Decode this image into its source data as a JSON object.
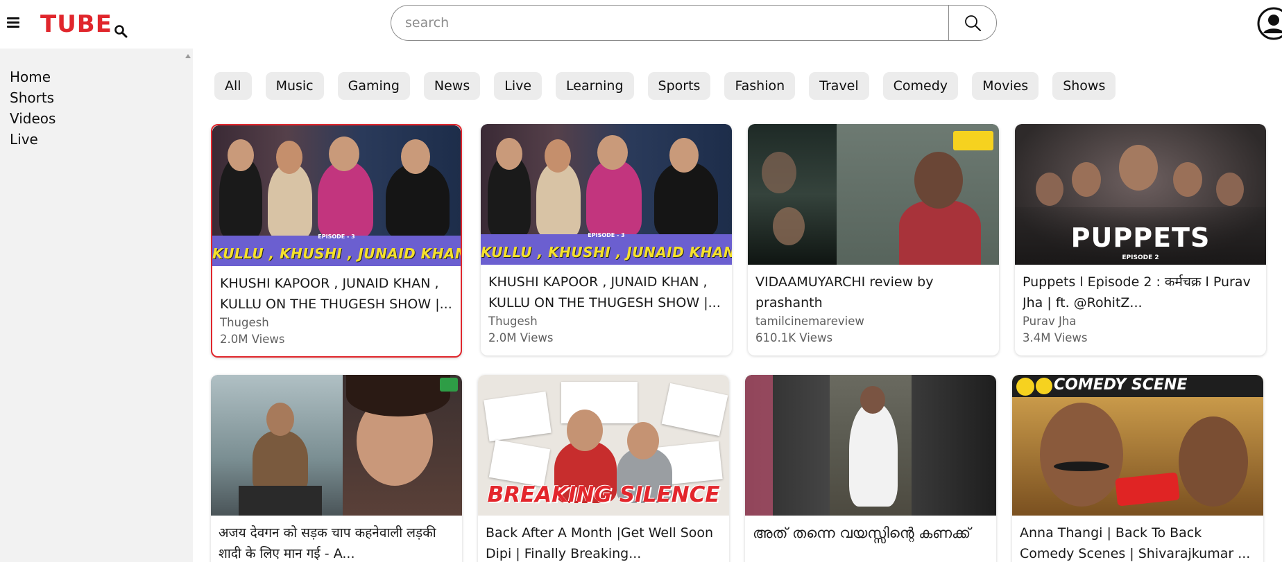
{
  "header": {
    "logo_text": "TUBE",
    "logo_icon": "magnifier-icon",
    "search_placeholder": "search",
    "search_icon": "search-icon",
    "avatar_icon": "user-avatar-icon",
    "menu_icon": "hamburger-menu-icon",
    "brand_color": "#e0262c"
  },
  "sidebar": {
    "items": [
      {
        "label": "Home"
      },
      {
        "label": "Shorts"
      },
      {
        "label": "Videos"
      },
      {
        "label": "Live"
      }
    ]
  },
  "chips": [
    {
      "label": "All"
    },
    {
      "label": "Music"
    },
    {
      "label": "Gaming"
    },
    {
      "label": "News"
    },
    {
      "label": "Live"
    },
    {
      "label": "Learning"
    },
    {
      "label": "Sports"
    },
    {
      "label": "Fashion"
    },
    {
      "label": "Travel"
    },
    {
      "label": "Comedy"
    },
    {
      "label": "Movies"
    },
    {
      "label": "Shows"
    }
  ],
  "videos": [
    {
      "title": "KHUSHI KAPOOR , JUNAID KHAN , KULLU ON THE THUGESH SHOW |...",
      "channel": "Thugesh",
      "views": "2.0M Views",
      "thumb_caption": "KULLU , KHUSHI , JUNAID  KHAN",
      "thumb_subcaption": "EPISODE - 3",
      "selected": true
    },
    {
      "title": "KHUSHI KAPOOR , JUNAID KHAN , KULLU ON THE THUGESH SHOW |...",
      "channel": "Thugesh",
      "views": "2.0M Views",
      "thumb_caption": "KULLU , KHUSHI , JUNAID  KHAN",
      "thumb_subcaption": "EPISODE - 3"
    },
    {
      "title": "VIDAAMUYARCHI review by prashanth",
      "channel": "tamilcinemareview",
      "views": "610.1K Views"
    },
    {
      "title": "Puppets l Episode 2 : कर्मचक्र l Purav Jha | ft. @RohitZ...",
      "channel": "Purav Jha",
      "views": "3.4M Views",
      "thumb_caption": "PUPPETS",
      "thumb_subcaption": "EPISODE 2"
    },
    {
      "title": "अजय देवगन को सड़क चाप कहनेवाली लड़की शादी के लिए मान गई - A..."
    },
    {
      "title": "Back After A Month |Get Well Soon Dipi | Finally Breaking...",
      "thumb_caption": "BREAKING SILENCE"
    },
    {
      "title": "അത് തന്നെ വയസ്സിന്റെ കണക്ക്"
    },
    {
      "title": "Anna Thangi | Back To Back Comedy Scenes | Shivarajkumar ...",
      "thumb_caption": "COMEDY SCENE"
    }
  ]
}
